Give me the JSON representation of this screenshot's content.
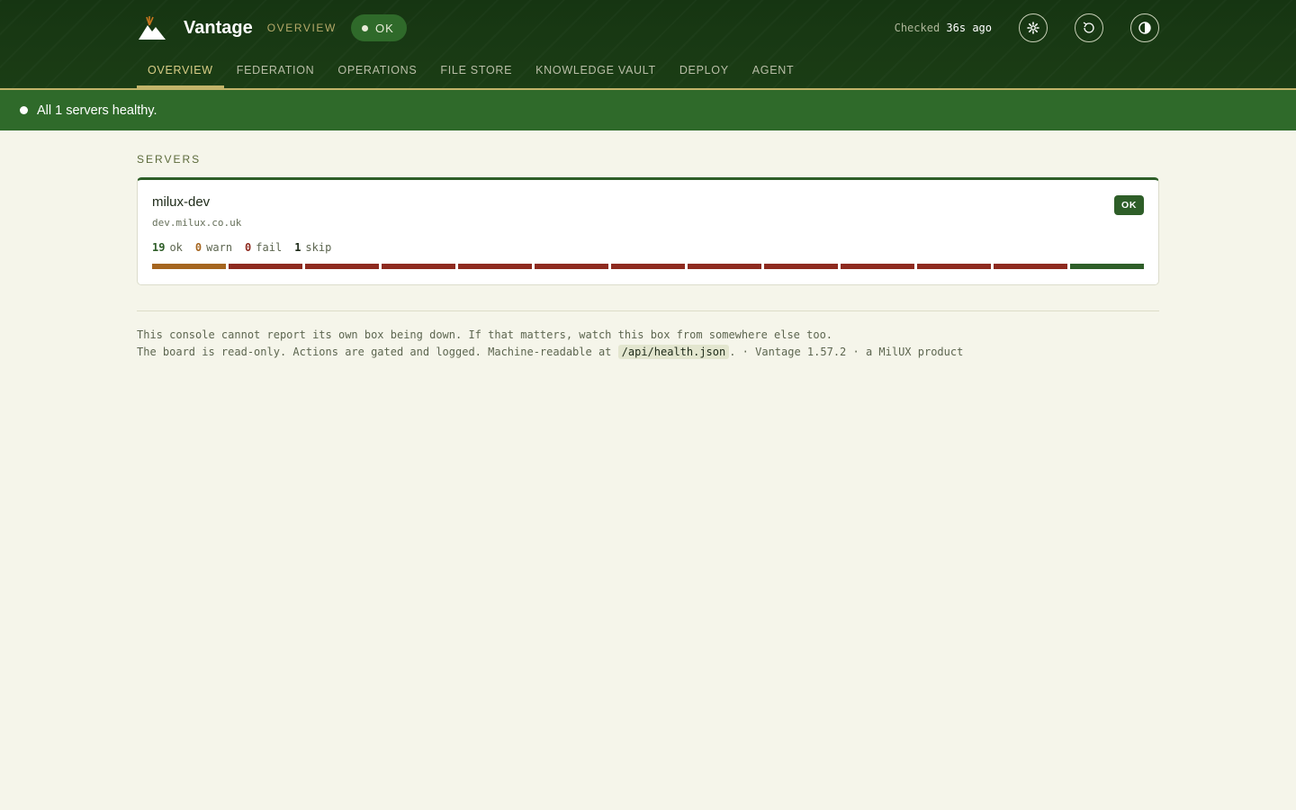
{
  "header": {
    "brand": "Vantage",
    "section_label": "OVERVIEW",
    "status_pill": "OK",
    "checked_label": "Checked",
    "checked_value": "36s ago",
    "icons": [
      "gear-icon",
      "refresh-icon",
      "contrast-icon"
    ]
  },
  "tabs": [
    {
      "label": "OVERVIEW",
      "active": true
    },
    {
      "label": "FEDERATION",
      "active": false
    },
    {
      "label": "OPERATIONS",
      "active": false
    },
    {
      "label": "FILE STORE",
      "active": false
    },
    {
      "label": "KNOWLEDGE VAULT",
      "active": false
    },
    {
      "label": "DEPLOY",
      "active": false
    },
    {
      "label": "AGENT",
      "active": false
    }
  ],
  "banner": {
    "message": "All 1 servers healthy."
  },
  "servers": {
    "title": "SERVERS",
    "items": [
      {
        "name": "milux-dev",
        "host": "dev.milux.co.uk",
        "badge": "OK",
        "counts": {
          "ok": "19",
          "ok_label": "ok",
          "warn": "0",
          "warn_label": "warn",
          "fail": "0",
          "fail_label": "fail",
          "skip": "1",
          "skip_label": "skip"
        },
        "history": [
          "warn",
          "fail",
          "fail",
          "fail",
          "fail",
          "fail",
          "fail",
          "fail",
          "fail",
          "fail",
          "fail",
          "fail",
          "ok"
        ]
      }
    ]
  },
  "footer": {
    "line1": "This console cannot report its own box being down. If that matters, watch this box from somewhere else too.",
    "line2_prefix": "The board is read-only. Actions are gated and logged. Machine-readable at",
    "api_path": "/api/health.json",
    "line2_suffix": ". · Vantage 1.57.2 · a MilUX product"
  },
  "colors": {
    "header_bg": "#163512",
    "accent_gold": "#c2b46a",
    "ok_green": "#2e5e28",
    "warn_orange": "#a5651f",
    "fail_red": "#8e2a1f",
    "page_bg": "#f5f5ea"
  }
}
